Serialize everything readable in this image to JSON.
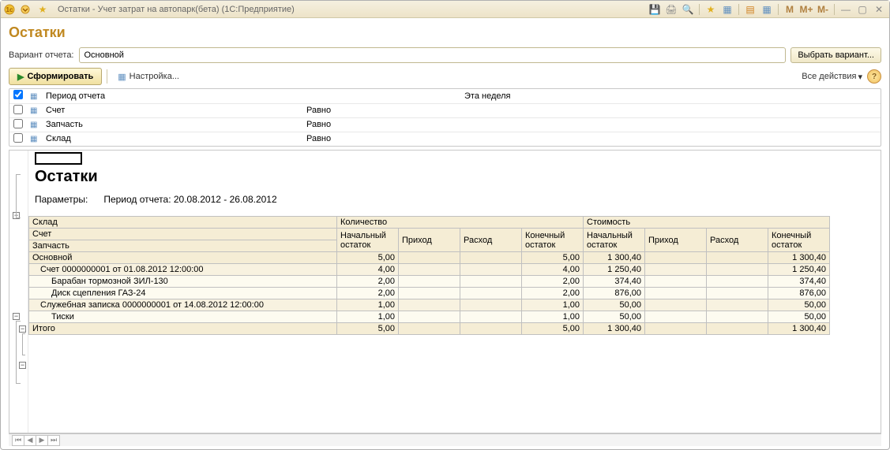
{
  "titlebar": {
    "title": "Остатки - Учет затрат на автопарк(бета)  (1С:Предприятие)",
    "m_buttons": [
      "M",
      "M+",
      "M-"
    ]
  },
  "page_title": "Остатки",
  "variant": {
    "label": "Вариант отчета:",
    "value": "Основной",
    "select_button": "Выбрать вариант..."
  },
  "toolbar": {
    "form_label": "Сформировать",
    "settings_label": "Настройка...",
    "all_actions": "Все действия"
  },
  "filters": [
    {
      "checked": true,
      "name": "Период отчета",
      "cond": "",
      "value": "Эта неделя"
    },
    {
      "checked": false,
      "name": "Счет",
      "cond": "Равно",
      "value": ""
    },
    {
      "checked": false,
      "name": "Запчасть",
      "cond": "Равно",
      "value": ""
    },
    {
      "checked": false,
      "name": "Склад",
      "cond": "Равно",
      "value": ""
    }
  ],
  "report": {
    "title": "Остатки",
    "params_label": "Параметры:",
    "params_value": "Период отчета: 20.08.2012 - 26.08.2012",
    "header_rows": {
      "r1": {
        "sklad": "Склад",
        "qty": "Количество",
        "cost": "Стоимость"
      },
      "r2": {
        "schet": "Счет",
        "q1": "Начальный остаток",
        "q2": "Приход",
        "q3": "Расход",
        "q4": "Конечный остаток",
        "v1": "Начальный остаток",
        "v2": "Приход",
        "v3": "Расход",
        "v4": "Конечный остаток"
      },
      "r3": {
        "zap": "Запчасть"
      }
    },
    "rows": [
      {
        "lvl": 0,
        "name": "Основной",
        "q1": "5,00",
        "q2": "",
        "q3": "",
        "q4": "5,00",
        "v1": "1 300,40",
        "v2": "",
        "v3": "",
        "v4": "1 300,40"
      },
      {
        "lvl": 1,
        "name": "Счет 0000000001 от 01.08.2012 12:00:00",
        "q1": "4,00",
        "q2": "",
        "q3": "",
        "q4": "4,00",
        "v1": "1 250,40",
        "v2": "",
        "v3": "",
        "v4": "1 250,40"
      },
      {
        "lvl": 2,
        "name": "Барабан тормозной ЗИЛ-130",
        "q1": "2,00",
        "q2": "",
        "q3": "",
        "q4": "2,00",
        "v1": "374,40",
        "v2": "",
        "v3": "",
        "v4": "374,40"
      },
      {
        "lvl": 2,
        "name": "Диск сцепления ГАЗ-24",
        "q1": "2,00",
        "q2": "",
        "q3": "",
        "q4": "2,00",
        "v1": "876,00",
        "v2": "",
        "v3": "",
        "v4": "876,00"
      },
      {
        "lvl": 1,
        "name": "Служебная записка 0000000001 от 14.08.2012 12:00:00",
        "q1": "1,00",
        "q2": "",
        "q3": "",
        "q4": "1,00",
        "v1": "50,00",
        "v2": "",
        "v3": "",
        "v4": "50,00"
      },
      {
        "lvl": 2,
        "name": "Тиски",
        "q1": "1,00",
        "q2": "",
        "q3": "",
        "q4": "1,00",
        "v1": "50,00",
        "v2": "",
        "v3": "",
        "v4": "50,00"
      }
    ],
    "total": {
      "name": "Итого",
      "q1": "5,00",
      "q2": "",
      "q3": "",
      "q4": "5,00",
      "v1": "1 300,40",
      "v2": "",
      "v3": "",
      "v4": "1 300,40"
    }
  }
}
